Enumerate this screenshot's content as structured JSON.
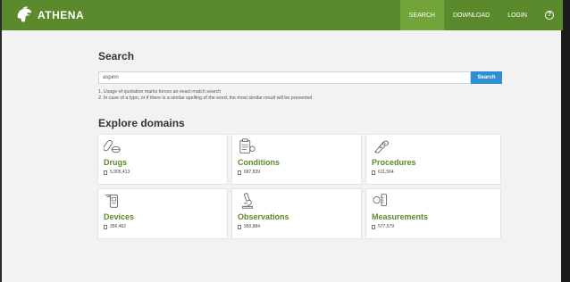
{
  "header": {
    "brand": "ATHENA",
    "nav": [
      {
        "label": "SEARCH",
        "active": true
      },
      {
        "label": "DOWNLOAD",
        "active": false
      },
      {
        "label": "LOGIN",
        "active": false
      }
    ],
    "help_symbol": "?"
  },
  "search": {
    "heading": "Search",
    "value": "aspirin",
    "button": "Search",
    "notes": [
      "1. Usage of quotation marks forces an exact-match search",
      "2. In case of a typo, or if there is a similar spelling of the word, the most similar result will be presented"
    ]
  },
  "explore": {
    "heading": "Explore domains",
    "domains": [
      {
        "name": "Drugs",
        "count": "5,905,413",
        "icon": "pills-icon"
      },
      {
        "name": "Conditions",
        "count": "687,839",
        "icon": "clipboard-icon"
      },
      {
        "name": "Procedures",
        "count": "611,564",
        "icon": "scalpel-icon"
      },
      {
        "name": "Devices",
        "count": "356,462",
        "icon": "device-icon"
      },
      {
        "name": "Observations",
        "count": "950,884",
        "icon": "microscope-icon"
      },
      {
        "name": "Measurements",
        "count": "577,579",
        "icon": "measuring-icon"
      }
    ]
  },
  "colors": {
    "brand_green": "#5b8a2c",
    "active_tab": "#73a43a",
    "search_button": "#2f8fd4"
  }
}
